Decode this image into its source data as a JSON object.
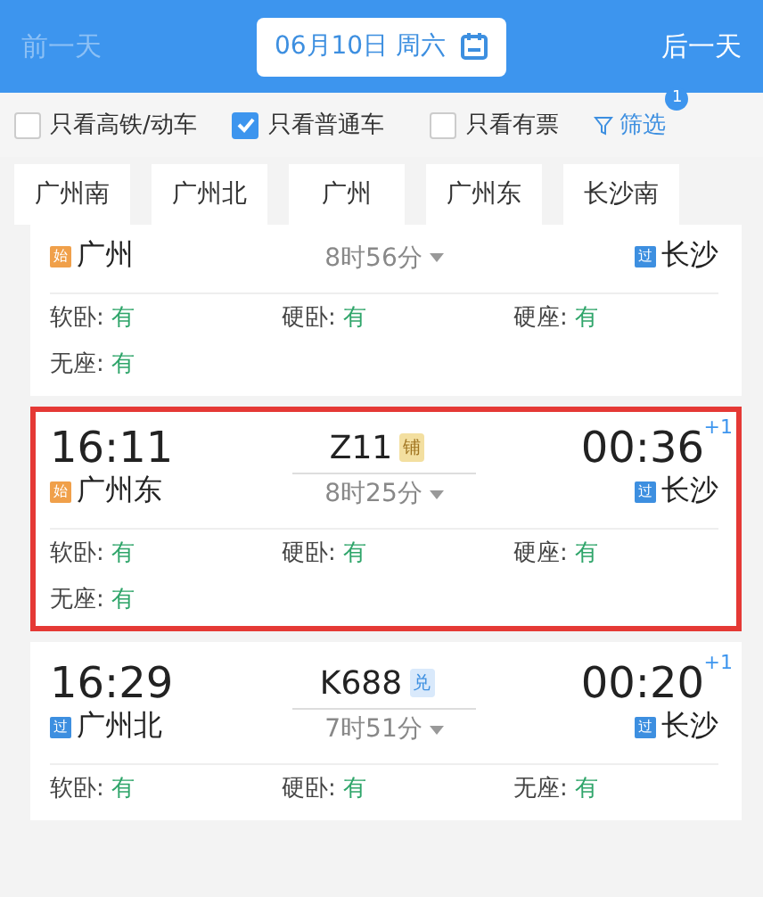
{
  "header": {
    "prev_day": {
      "label": "前一天",
      "disabled": true
    },
    "date": "06月10日 周六",
    "next_day": {
      "label": "后一天",
      "disabled": false
    }
  },
  "filters": [
    {
      "label": "只看高铁/动车",
      "checked": false
    },
    {
      "label": "只看普通车",
      "checked": true
    },
    {
      "label": "只看有票",
      "checked": false
    }
  ],
  "filter_button": {
    "label": "筛选",
    "badge": "1"
  },
  "stations": [
    {
      "label": "广州南",
      "selected": false
    },
    {
      "label": "广州北",
      "selected": false
    },
    {
      "label": "广州",
      "selected": false
    },
    {
      "label": "广州东",
      "selected": false
    },
    {
      "label": "长沙南",
      "selected": false
    }
  ],
  "trains": [
    {
      "highlighted": false,
      "from": {
        "tag": "始",
        "kind": "start",
        "name": "广州"
      },
      "duration": "8时56分",
      "to": {
        "tag": "过",
        "kind": "pass",
        "name": "长沙"
      },
      "seats": [
        {
          "type": "软卧:",
          "status": "有"
        },
        {
          "type": "硬卧:",
          "status": "有"
        },
        {
          "type": "硬座:",
          "status": "有"
        },
        {
          "type": "无座:",
          "status": "有"
        }
      ]
    },
    {
      "highlighted": true,
      "depart": "16:11",
      "number": "Z11",
      "number_tag": {
        "text": "铺",
        "kind": "sleeper"
      },
      "arrive": "00:36",
      "day_offset": "+1",
      "from": {
        "tag": "始",
        "kind": "start",
        "name": "广州东"
      },
      "duration": "8时25分",
      "to": {
        "tag": "过",
        "kind": "pass",
        "name": "长沙"
      },
      "seats": [
        {
          "type": "软卧:",
          "status": "有"
        },
        {
          "type": "硬卧:",
          "status": "有"
        },
        {
          "type": "硬座:",
          "status": "有"
        },
        {
          "type": "无座:",
          "status": "有"
        }
      ]
    },
    {
      "highlighted": false,
      "depart": "16:29",
      "number": "K688",
      "number_tag": {
        "text": "兑",
        "kind": "exchange"
      },
      "arrive": "00:20",
      "day_offset": "+1",
      "from": {
        "tag": "过",
        "kind": "pass",
        "name": "广州北"
      },
      "duration": "7时51分",
      "to": {
        "tag": "过",
        "kind": "pass",
        "name": "长沙"
      },
      "seats": [
        {
          "type": "软卧:",
          "status": "有"
        },
        {
          "type": "硬卧:",
          "status": "有"
        },
        {
          "type": "无座:",
          "status": "有"
        }
      ]
    }
  ]
}
